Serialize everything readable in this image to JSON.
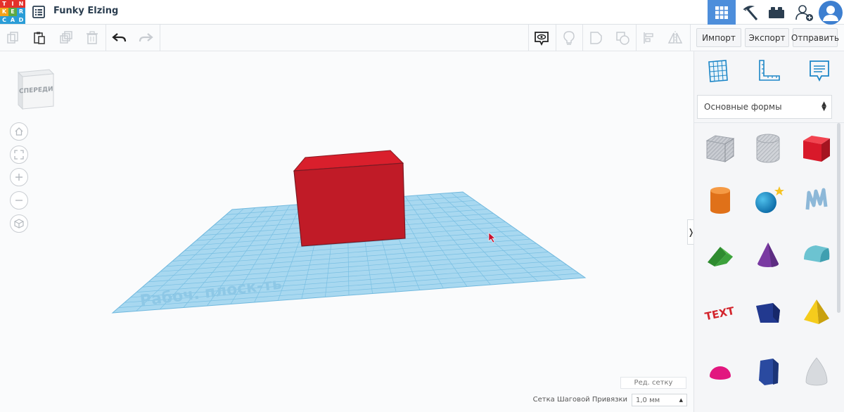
{
  "app": {
    "logo_letters": [
      "T",
      "I",
      "N",
      "K",
      "E",
      "R",
      "C",
      "A",
      "D"
    ],
    "logo_colors": [
      "#e4312b",
      "#e4312b",
      "#e4312b",
      "#f3a21a",
      "#5da943",
      "#2a9dd7",
      "#2a9dd7",
      "#2a9dd7",
      "#2a9dd7"
    ],
    "project_title": "Funky Elzing"
  },
  "top_tabs": [
    {
      "name": "3d-design-tab",
      "icon": "grid-icon",
      "active": true
    },
    {
      "name": "circuits-tab",
      "icon": "pickaxe-icon",
      "active": false
    },
    {
      "name": "bricks-tab",
      "icon": "brick-icon",
      "active": false
    }
  ],
  "toolbar": {
    "buttons": [
      "copy-icon",
      "paste-icon",
      "duplicate-icon",
      "delete-icon",
      "undo-icon",
      "redo-icon"
    ],
    "view_buttons": [
      "notes-visibility-icon",
      "light-bulb-icon",
      "group-icon",
      "ungroup-icon",
      "align-icon",
      "mirror-icon"
    ],
    "import_label": "Импорт",
    "export_label": "Экспорт",
    "send_label": "Отправить"
  },
  "workspace": {
    "view_cube_label": "СПЕРЕДИ",
    "nav_buttons": [
      "home-icon",
      "fit-all-icon",
      "zoom-in-icon",
      "zoom-out-icon",
      "perspective-icon"
    ],
    "workplane_watermark": "Рабоч. плоск-ть",
    "edit_grid_label": "Ред. сетку",
    "snap_grid_label": "Сетка Шаговой Привязки",
    "snap_grid_value": "1,0 мм",
    "collapse_label": "❭"
  },
  "panel": {
    "icons": [
      "workplane-icon",
      "ruler-icon",
      "notes-icon"
    ],
    "category": "Основные формы",
    "shapes": [
      {
        "name": "box-hole",
        "color": "#b8bcc4"
      },
      {
        "name": "cylinder-hole",
        "color": "#c3c7cf"
      },
      {
        "name": "box",
        "color": "#e11b25"
      },
      {
        "name": "cylinder",
        "color": "#e8781f"
      },
      {
        "name": "sphere",
        "color": "#1b8bc6"
      },
      {
        "name": "scribble",
        "color": "#8cb7d6"
      },
      {
        "name": "roof",
        "color": "#3aa33c"
      },
      {
        "name": "cone",
        "color": "#8241a8"
      },
      {
        "name": "round-roof",
        "color": "#58b5c6"
      },
      {
        "name": "text",
        "color": "#d3252d"
      },
      {
        "name": "wedge",
        "color": "#22398f"
      },
      {
        "name": "pyramid",
        "color": "#f2c514"
      },
      {
        "name": "half-sphere",
        "color": "#e2177f"
      },
      {
        "name": "polygon",
        "color": "#2a4aa0"
      },
      {
        "name": "paraboloid",
        "color": "#d0d3d8"
      }
    ]
  }
}
